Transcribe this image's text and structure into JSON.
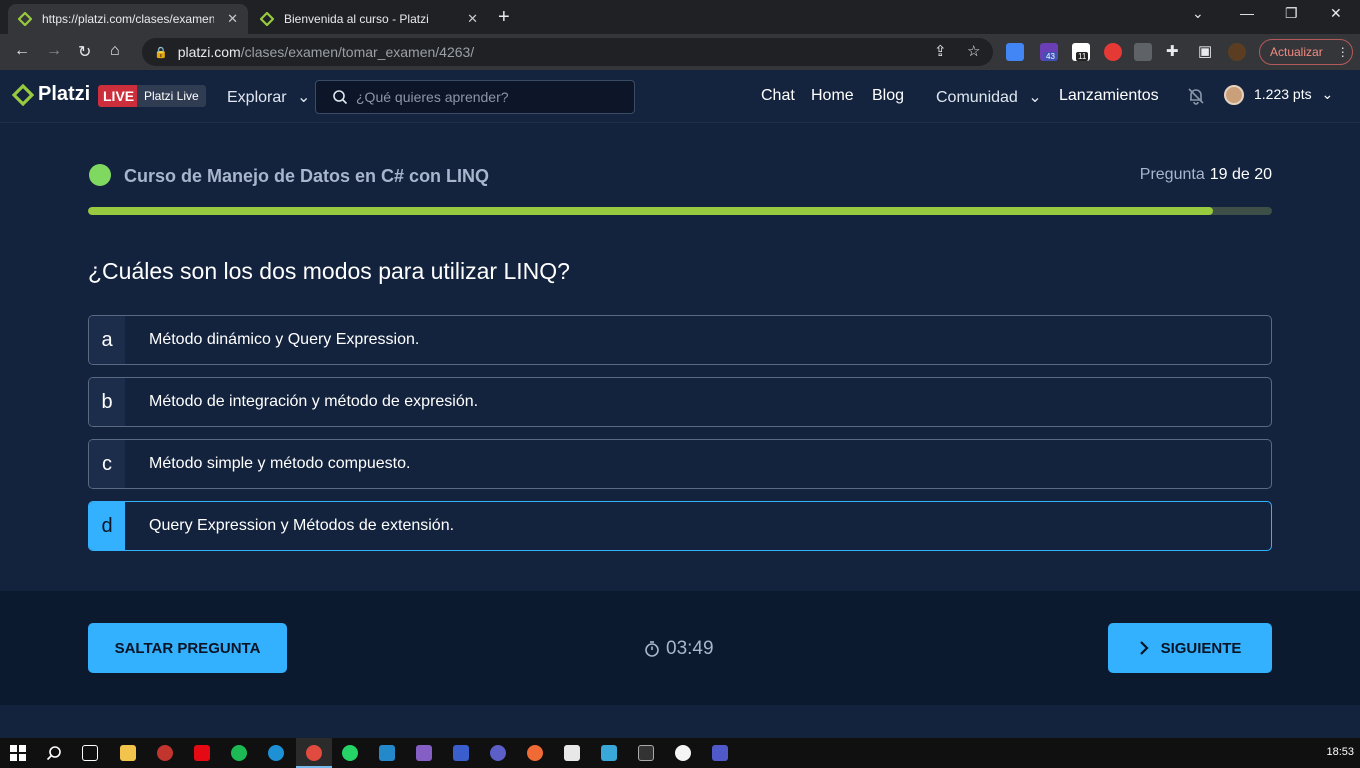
{
  "browser": {
    "tabs": [
      {
        "title": "https://platzi.com/clases/examen",
        "active": true
      },
      {
        "title": "Bienvenida al curso - Platzi",
        "active": false
      }
    ],
    "address": {
      "host": "platzi.com",
      "path": "/clases/examen/tomar_examen/4263/"
    },
    "extension_badges": {
      "first": "43",
      "second": "11"
    },
    "update_label": "Actualizar"
  },
  "header": {
    "logo_text": "Platzi",
    "live_badge": "LIVE",
    "live_name": "Platzi Live",
    "explore_label": "Explorar",
    "search_placeholder": "¿Qué quieres aprender?",
    "nav": [
      "Chat",
      "Home",
      "Blog"
    ],
    "community_label": "Comunidad",
    "launches_label": "Lanzamientos",
    "points": "1.223 pts"
  },
  "exam": {
    "course_title": "Curso de Manejo de Datos en C# con LINQ",
    "question_label": "Pregunta",
    "question_progress": "19 de 20",
    "progress_fraction": 0.95,
    "question": "¿Cuáles son los dos modos para utilizar LINQ?",
    "options": [
      {
        "letter": "a",
        "text": "Método dinámico y Query Expression.",
        "selected": false
      },
      {
        "letter": "b",
        "text": "Método de integración y método de expresión.",
        "selected": false
      },
      {
        "letter": "c",
        "text": "Método simple y método compuesto.",
        "selected": false
      },
      {
        "letter": "d",
        "text": "Query Expression y Métodos de extensión.",
        "selected": true
      }
    ]
  },
  "footer": {
    "skip_label": "SALTAR PREGUNTA",
    "timer": "03:49",
    "next_label": "SIGUIENTE"
  },
  "taskbar": {
    "clock": "18:53"
  },
  "colors": {
    "accent": "#33b1ff",
    "progress": "#98ca3f",
    "background": "#13233d",
    "live": "#cc2e3b"
  }
}
